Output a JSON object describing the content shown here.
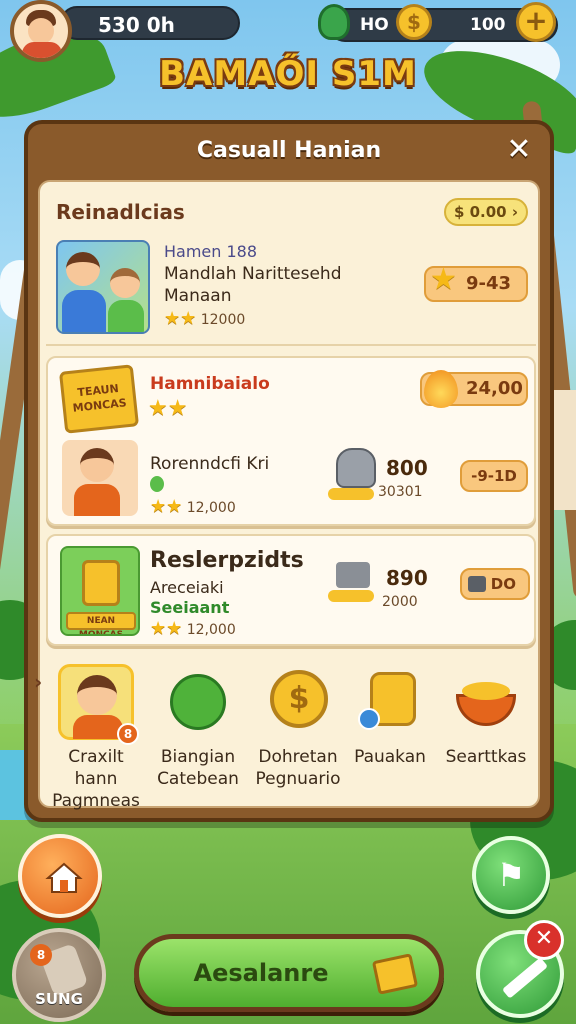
{
  "hud": {
    "coins": "530 0h",
    "resource_1": "HO",
    "resource_2": "100",
    "plus": "+"
  },
  "game_title": "BAMAŐI S1M",
  "panel": {
    "title": "Casuall Hanian",
    "close": "✕",
    "section1": {
      "title": "Reinadlcias",
      "pill": "$ 0.00 ›",
      "line1": "Hamen 188",
      "line2": "Mandlah Narittesehd",
      "line3": "Manaan",
      "rating": "12000",
      "price": "9-43"
    },
    "section2": {
      "badge": "TEAUN MONCAS",
      "title": "Hamnibaialo",
      "price": "24,00",
      "item_name": "Rorenndcfi Kri",
      "rating": "12,000",
      "amount": "800",
      "subamount": "30301",
      "action": "-9-1D"
    },
    "section3": {
      "badge": "NEAN MONCAS",
      "title": "Reslerpzidts",
      "line2": "Areceiaki",
      "line3": "Seeiaant",
      "rating": "12,000",
      "amount": "890",
      "subamount": "2000",
      "action": "DO"
    },
    "icons": [
      {
        "name": "Craxilt hann",
        "sub": "Pagmneas",
        "badge": "8"
      },
      {
        "name": "Biangian",
        "sub": "Catebean"
      },
      {
        "name": "Dohretan",
        "sub": "Pegnuario"
      },
      {
        "name": "Pauakan",
        "sub": ""
      },
      {
        "name": "Searttkas",
        "sub": ""
      }
    ]
  },
  "buttons": {
    "main": "Aesalanre",
    "bag": "SUNG",
    "bag_badge": "8",
    "x_badge": "✕"
  }
}
